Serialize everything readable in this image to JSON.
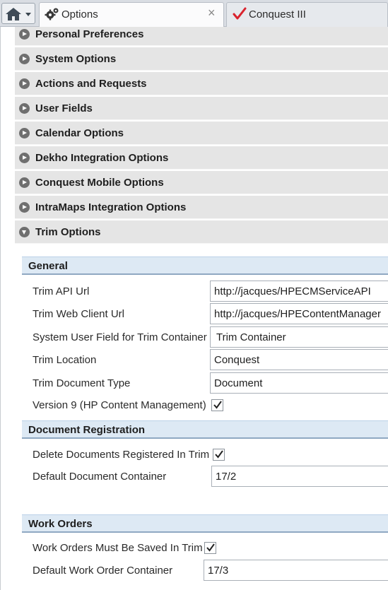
{
  "tabs": [
    {
      "label": "Options",
      "icon": "gears-icon",
      "active": true
    },
    {
      "label": "Conquest III",
      "icon": "red-check-icon",
      "active": false
    }
  ],
  "sections": [
    {
      "title": "Personal Preferences",
      "expanded": false
    },
    {
      "title": "System Options",
      "expanded": false
    },
    {
      "title": "Actions and Requests",
      "expanded": false
    },
    {
      "title": "User Fields",
      "expanded": false
    },
    {
      "title": "Calendar Options",
      "expanded": false
    },
    {
      "title": "Dekho Integration Options",
      "expanded": false
    },
    {
      "title": "Conquest Mobile Options",
      "expanded": false
    },
    {
      "title": "IntraMaps Integration Options",
      "expanded": false
    },
    {
      "title": "Trim Options",
      "expanded": true
    }
  ],
  "trim": {
    "general": {
      "title": "General",
      "api_url_label": "Trim API Url",
      "api_url_value": "http://jacques/HPECMServiceAPI",
      "web_client_label": "Trim Web Client Url",
      "web_client_value": "http://jacques/HPEContentManager",
      "user_field_label": "System User Field for Trim Container",
      "user_field_value": "Trim Container",
      "location_label": "Trim Location",
      "location_value": "Conquest",
      "doc_type_label": "Trim Document Type",
      "doc_type_value": "Document",
      "version9_label": "Version 9 (HP Content Management)",
      "version9_checked": true
    },
    "doc_registration": {
      "title": "Document Registration",
      "delete_label": "Delete Documents Registered In Trim",
      "delete_checked": true,
      "default_container_label": "Default Document Container",
      "default_container_value": "17/2"
    },
    "work_orders": {
      "title": "Work Orders",
      "must_save_label": "Work Orders Must Be Saved In Trim",
      "must_save_checked": true,
      "default_container_label": "Default Work Order Container",
      "default_container_value": "17/3"
    }
  },
  "colors": {
    "section_bg": "#e5e5e5",
    "group_bg": "#dde9f4",
    "group_border": "#8fa8c2",
    "check_red": "#d9232e"
  }
}
